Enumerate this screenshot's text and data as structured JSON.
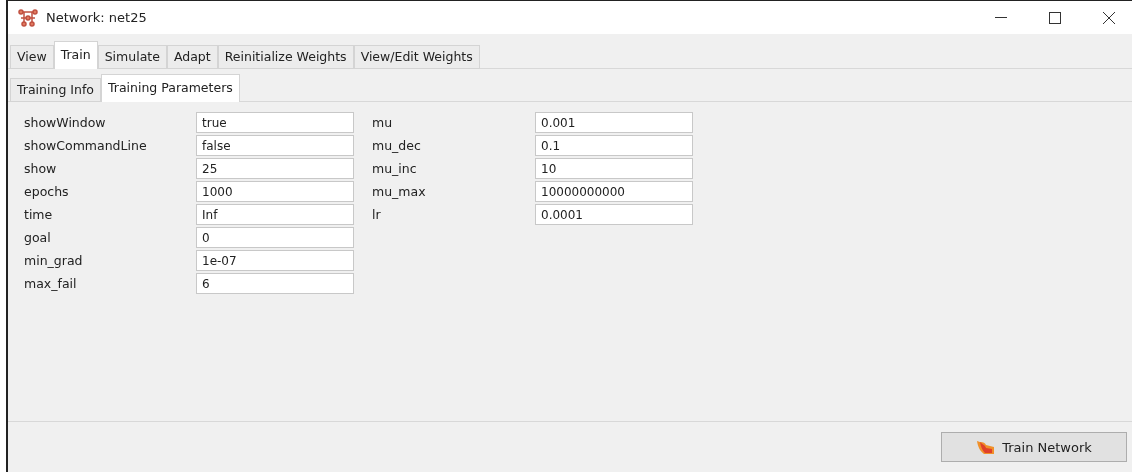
{
  "window": {
    "title": "Network: net25"
  },
  "tabs": [
    {
      "label": "View",
      "selected": false
    },
    {
      "label": "Train",
      "selected": true
    },
    {
      "label": "Simulate",
      "selected": false
    },
    {
      "label": "Adapt",
      "selected": false
    },
    {
      "label": "Reinitialize Weights",
      "selected": false
    },
    {
      "label": "View/Edit Weights",
      "selected": false
    }
  ],
  "subtabs": [
    {
      "label": "Training Info",
      "selected": false
    },
    {
      "label": "Training Parameters",
      "selected": true
    }
  ],
  "parameters": [
    [
      {
        "label": "showWindow",
        "value": "true"
      },
      {
        "label": "showCommandLine",
        "value": "false"
      },
      {
        "label": "show",
        "value": "25"
      },
      {
        "label": "epochs",
        "value": "1000"
      },
      {
        "label": "time",
        "value": "Inf"
      },
      {
        "label": "goal",
        "value": "0"
      },
      {
        "label": "min_grad",
        "value": "1e-07"
      },
      {
        "label": "max_fail",
        "value": "6"
      }
    ],
    [
      {
        "label": "mu",
        "value": "0.001"
      },
      {
        "label": "mu_dec",
        "value": "0.1"
      },
      {
        "label": "mu_inc",
        "value": "10"
      },
      {
        "label": "mu_max",
        "value": "10000000000"
      },
      {
        "label": "lr",
        "value": "0.0001"
      }
    ]
  ],
  "train_button": {
    "label": "Train Network"
  }
}
